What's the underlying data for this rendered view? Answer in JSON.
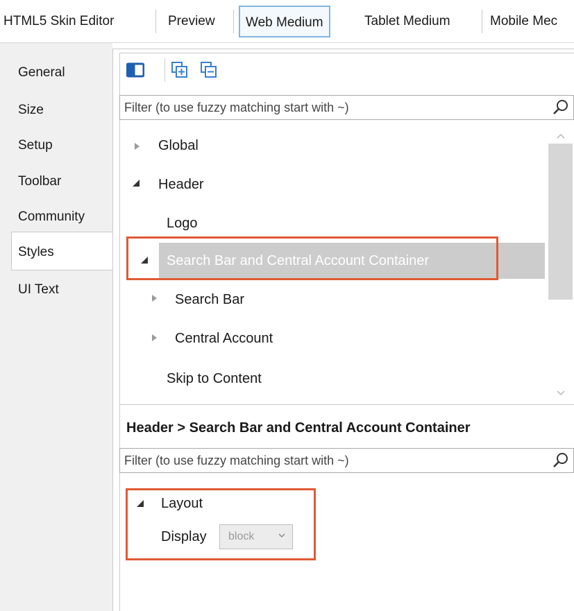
{
  "top_tabs": [
    {
      "label": "HTML5 Skin Editor",
      "selected": false
    },
    {
      "label": "Preview",
      "selected": false
    },
    {
      "label": "Web Medium",
      "selected": true
    },
    {
      "label": "Tablet Medium",
      "selected": false
    },
    {
      "label": "Mobile Mec",
      "selected": false
    }
  ],
  "side_tabs": [
    {
      "label": "General"
    },
    {
      "label": "Size"
    },
    {
      "label": "Setup"
    },
    {
      "label": "Toolbar"
    },
    {
      "label": "Community"
    },
    {
      "label": "Styles",
      "selected": true
    },
    {
      "label": "UI Text"
    }
  ],
  "toolbar": {
    "icons": [
      "panel-toggle-icon",
      "expand-all-icon",
      "collapse-all-icon"
    ]
  },
  "styles_filter": {
    "placeholder": "Filter (to use fuzzy matching start with ~)"
  },
  "tree": {
    "items": [
      {
        "label": "Global",
        "expander": "collapsed"
      },
      {
        "label": "Header",
        "expander": "expanded"
      },
      {
        "label": "Logo",
        "expander": "none"
      },
      {
        "label": "Search Bar and Central Account Container",
        "expander": "expanded",
        "selected": true
      },
      {
        "label": "Search Bar",
        "expander": "collapsed"
      },
      {
        "label": "Central Account",
        "expander": "collapsed"
      },
      {
        "label": "Skip to Content",
        "expander": "none"
      }
    ]
  },
  "properties": {
    "breadcrumb": "Header > Search Bar and Central Account Container",
    "filter_placeholder": "Filter (to use fuzzy matching start with ~)",
    "groups": [
      {
        "label": "Layout",
        "expander": "expanded",
        "props": [
          {
            "label": "Display",
            "value": "block"
          }
        ]
      }
    ]
  },
  "colors": {
    "highlight_box": "#e05a34",
    "selected_row": "#cccccc",
    "selected_tab_border": "#7fb6e2",
    "panel_icon_blue": "#1e5fb3"
  }
}
